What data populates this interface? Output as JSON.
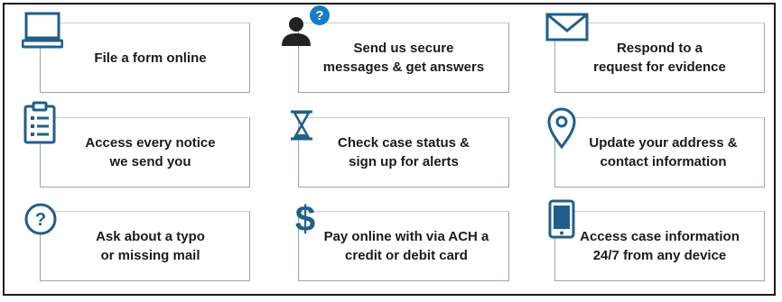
{
  "accent_color": "#1f5f8b",
  "cards": [
    {
      "icon": "laptop-icon",
      "label": "File a form online"
    },
    {
      "icon": "user-question-icon",
      "label": "Send us secure\nmessages & get answers"
    },
    {
      "icon": "envelope-icon",
      "label": "Respond to a\nrequest for evidence"
    },
    {
      "icon": "clipboard-list-icon",
      "label": "Access every notice\nwe send you"
    },
    {
      "icon": "hourglass-icon",
      "label": "Check case status &\nsign up for alerts"
    },
    {
      "icon": "location-pin-icon",
      "label": "Update your address &\ncontact information"
    },
    {
      "icon": "question-circle-icon",
      "label": "Ask about a typo\nor missing mail"
    },
    {
      "icon": "dollar-sign-icon",
      "label": "Pay online with via ACH a\ncredit or debit card"
    },
    {
      "icon": "mobile-phone-icon",
      "label": "Access case information\n24/7 from any device"
    }
  ]
}
